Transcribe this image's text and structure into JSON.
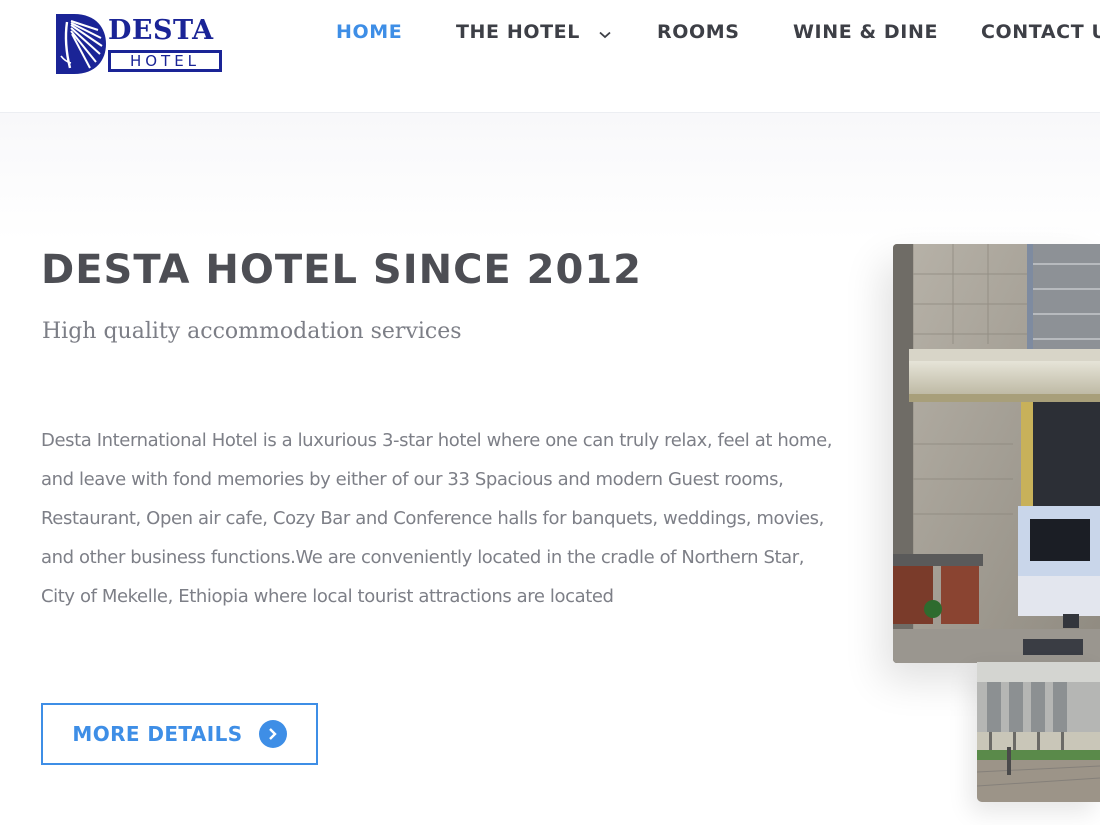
{
  "brand": {
    "line1": "DESTA",
    "line2": "HOTEL"
  },
  "nav": {
    "items": [
      {
        "label": "HOME",
        "active": true
      },
      {
        "label": "THE HOTEL",
        "has_dropdown": true
      },
      {
        "label": "ROOMS"
      },
      {
        "label": "WINE & DINE"
      },
      {
        "label": "CONTACT U"
      }
    ]
  },
  "hero": {
    "title": "DESTA HOTEL SINCE 2012",
    "subtitle": "High quality accommodation services",
    "body": "Desta International Hotel is a luxurious 3-star hotel where one can truly relax, feel at home, and leave with fond memories by either of our 33 Spacious and modern Guest rooms, Restaurant, Open air cafe, Cozy Bar and Conference halls for banquets, weddings, movies, and other business functions.We are conveniently located in the cradle of Northern Star, City of Mekelle, Ethiopia where local tourist attractions are located",
    "cta_label": "MORE DETAILS"
  },
  "colors": {
    "accent": "#3e8ee6",
    "brand_blue": "#1a2496",
    "nav_text": "#3d3f46",
    "title_text": "#4d4e54",
    "body_text": "#7d7f87"
  },
  "icons": {
    "nav_dropdown": "chevron-down-icon",
    "cta": "chevron-right-circle-icon"
  }
}
